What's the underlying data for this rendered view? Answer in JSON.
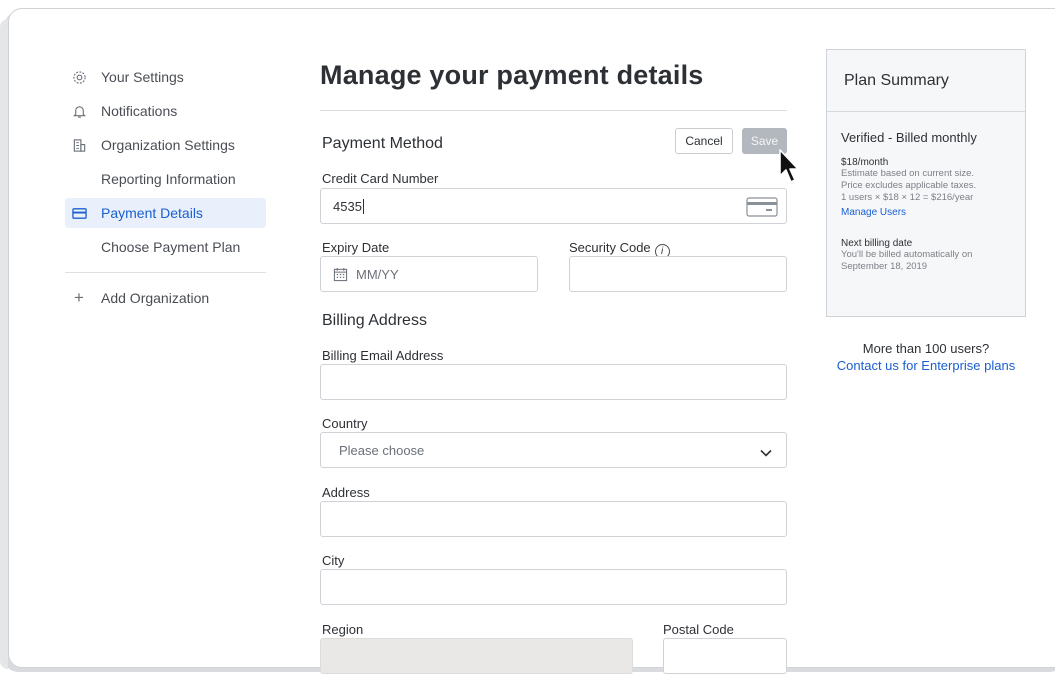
{
  "sidebar": {
    "items": [
      {
        "label": "Your Settings",
        "icon": "gear-icon"
      },
      {
        "label": "Notifications",
        "icon": "bell-icon"
      },
      {
        "label": "Organization Settings",
        "icon": "building-icon"
      },
      {
        "label": "Reporting Information",
        "icon": ""
      },
      {
        "label": "Payment Details",
        "icon": "credit-card-icon",
        "active": true
      },
      {
        "label": "Choose Payment Plan",
        "icon": ""
      }
    ],
    "add_org_label": "Add Organization"
  },
  "main": {
    "title": "Manage your payment details",
    "payment_method": {
      "title": "Payment Method",
      "cancel_label": "Cancel",
      "save_label": "Save",
      "card_number_label": "Credit Card Number",
      "card_number_value": "4535",
      "expiry_label": "Expiry Date",
      "expiry_placeholder": "MM/YY",
      "security_label": "Security Code"
    },
    "billing": {
      "title": "Billing Address",
      "email_label": "Billing Email Address",
      "country_label": "Country",
      "country_value": "Please choose",
      "address_label": "Address",
      "city_label": "City",
      "region_label": "Region",
      "postal_label": "Postal Code"
    }
  },
  "summary": {
    "title": "Plan Summary",
    "plan_name": "Verified - Billed monthly",
    "price": "$18/month",
    "estimate_1": "Estimate based on current size.",
    "estimate_2": "Price excludes applicable taxes.",
    "estimate_3": "1 users × $18 × 12 = $216/year",
    "manage_users": "Manage Users",
    "next_billing_title": "Next billing date",
    "next_billing_1": "You'll be billed automatically on",
    "next_billing_2": "September 18, 2019"
  },
  "enterprise": {
    "line1": "More than 100 users?",
    "link": "Contact us for Enterprise plans"
  },
  "colors": {
    "accent": "#1a5fd0",
    "active_bg": "#e9f0fb",
    "save_disabled": "#b3b8be"
  }
}
